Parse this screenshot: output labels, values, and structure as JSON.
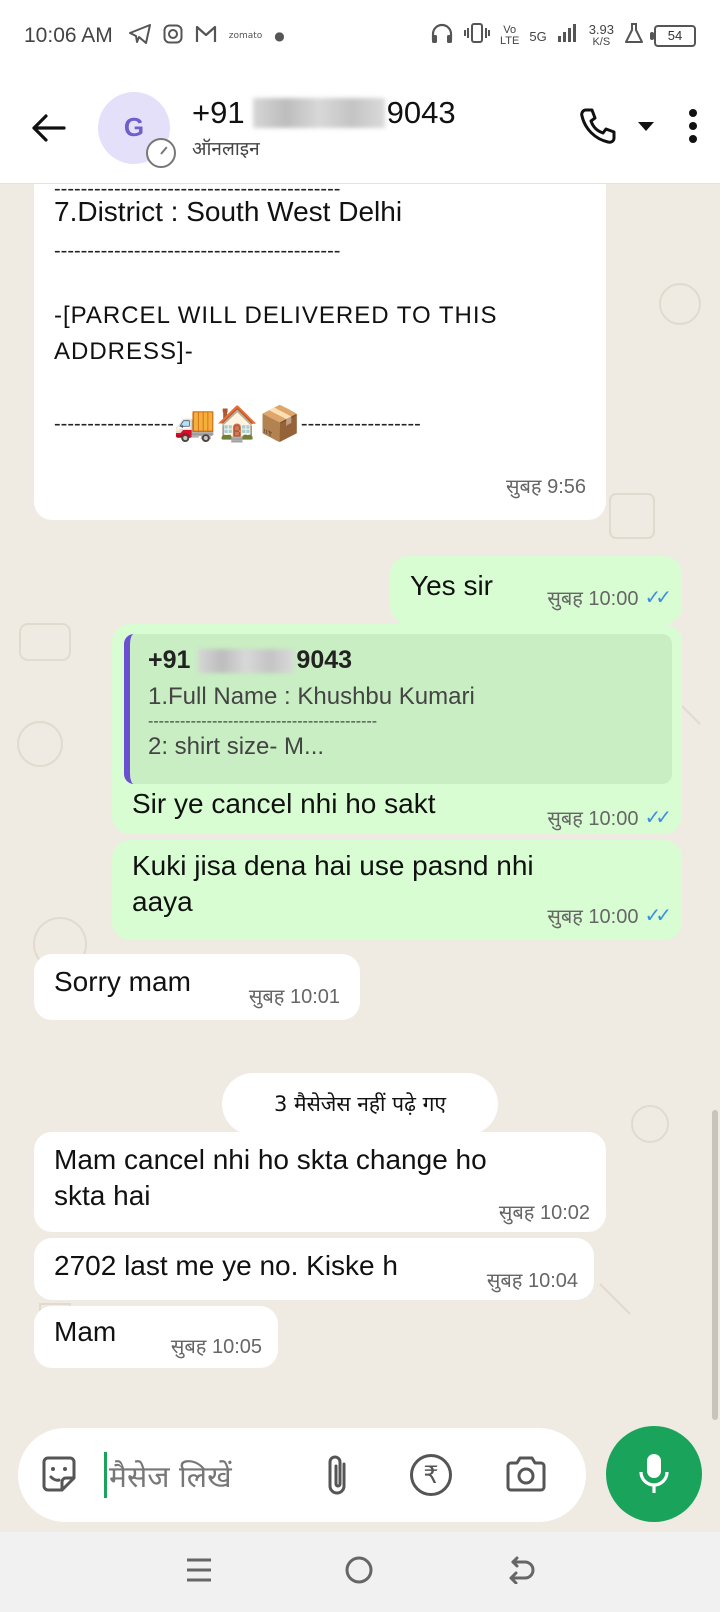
{
  "status_bar": {
    "time": "10:06 AM",
    "zomato_label": "zomato",
    "net_vo": "Vo",
    "net_lte": "LTE",
    "net_5g": "5G",
    "speed_value": "3.93",
    "speed_unit": "K/S",
    "battery": "54"
  },
  "header": {
    "avatar_letter": "G",
    "contact_prefix": "+91",
    "contact_suffix": "9043",
    "contact_status": "ऑनलाइन"
  },
  "messages": {
    "m1": {
      "dash_line": "-------------------------------------------",
      "district": "7.District : South West Delhi",
      "parcel_line1": "-[PARCEL WILL DELIVERED TO THIS",
      "parcel_line2": "ADDRESS]-",
      "dash_left": "------------------",
      "emojis": "🚚🏠📦",
      "dash_right": "------------------",
      "time": "सुबह 9:56"
    },
    "m2": {
      "text": "Yes sir",
      "time": "सुबह 10:00"
    },
    "m3": {
      "quote_prefix": "+91",
      "quote_suffix": "9043",
      "quote_line1": "1.Full Name : Khushbu Kumari",
      "quote_line2": "-------------------------------------------",
      "quote_line3": "2: shirt size- M...",
      "text": "Sir ye cancel nhi ho sakt",
      "time": "सुबह 10:00"
    },
    "m4": {
      "text_line1": "Kuki jisa dena hai use pasnd nhi",
      "text_line2": "aaya",
      "time": "सुबह 10:00"
    },
    "m5": {
      "text": "Sorry mam",
      "time": "सुबह 10:01"
    },
    "unread": "3 मैसेजेस नहीं पढ़े गए",
    "m6": {
      "text_line1": "Mam cancel nhi ho skta change ho",
      "text_line2": "skta hai",
      "time": "सुबह 10:02"
    },
    "m7": {
      "text": "2702 last me ye no. Kiske h",
      "time": "सुबह 10:04"
    },
    "m8": {
      "text": "Mam",
      "time": "सुबह 10:05"
    }
  },
  "composer": {
    "placeholder": "मैसेज लिखें",
    "rupee_symbol": "₹"
  },
  "colors": {
    "accent": "#1aa35a",
    "outgoing_bubble": "#d9fdd3",
    "incoming_bubble": "#ffffff",
    "read_ticks": "#3d8ee3",
    "chat_bg": "#efeae2"
  },
  "icons": [
    "back-arrow-icon",
    "phone-icon",
    "caret-down-icon",
    "more-vert-icon",
    "sticker-icon",
    "paperclip-icon",
    "rupee-icon",
    "camera-icon",
    "mic-icon",
    "menu-icon",
    "home-circle-icon",
    "nav-back-icon",
    "telegram-icon",
    "instagram-icon",
    "gmail-icon",
    "headphones-icon",
    "vibrate-icon",
    "signal-icon",
    "flask-icon",
    "timer-icon"
  ]
}
